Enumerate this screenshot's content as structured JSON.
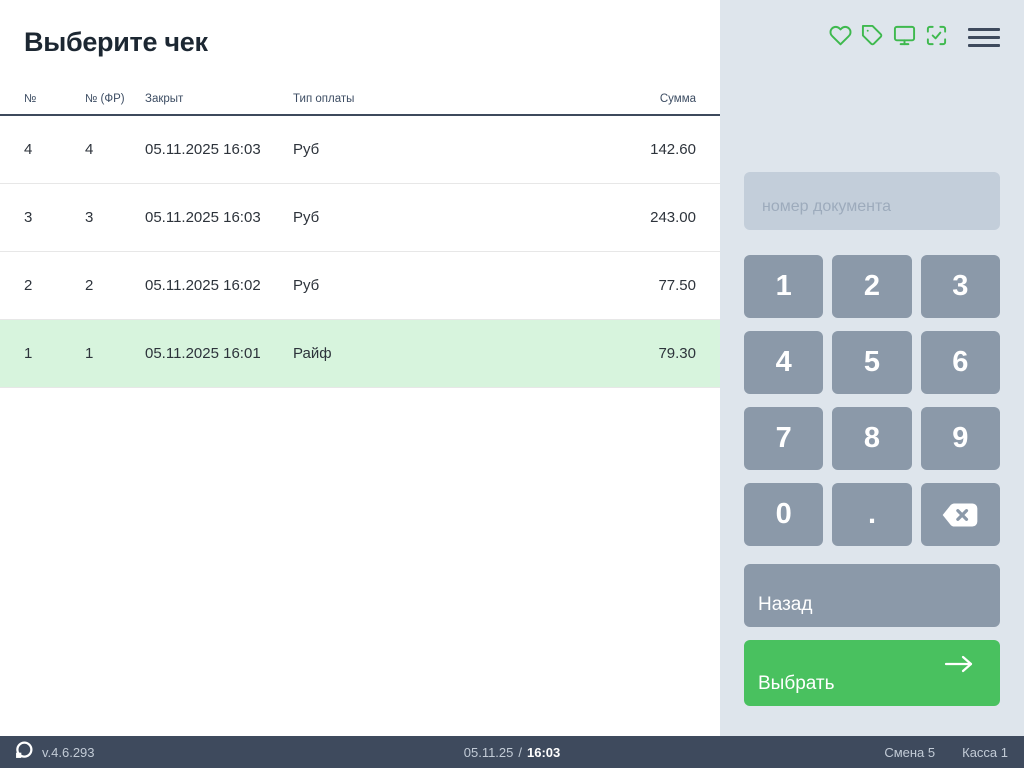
{
  "page": {
    "title": "Выберите чек"
  },
  "table": {
    "headers": {
      "num": "№",
      "num_fr": "№ (ФР)",
      "closed": "Закрыт",
      "payment": "Тип оплаты",
      "sum": "Сумма"
    },
    "rows": [
      {
        "num": "4",
        "num_fr": "4",
        "closed": "05.11.2025 16:03",
        "payment": "Руб",
        "sum": "142.60",
        "selected": false
      },
      {
        "num": "3",
        "num_fr": "3",
        "closed": "05.11.2025 16:03",
        "payment": "Руб",
        "sum": "243.00",
        "selected": false
      },
      {
        "num": "2",
        "num_fr": "2",
        "closed": "05.11.2025 16:02",
        "payment": "Руб",
        "sum": "77.50",
        "selected": false
      },
      {
        "num": "1",
        "num_fr": "1",
        "closed": "05.11.2025 16:01",
        "payment": "Райф",
        "sum": "79.30",
        "selected": true
      }
    ]
  },
  "sidebar": {
    "icons": [
      "heart-icon",
      "tag-icon",
      "monitor-icon",
      "scan-check-icon",
      "menu-icon"
    ],
    "doc_input": {
      "placeholder": "номер документа",
      "value": ""
    },
    "keypad": [
      "1",
      "2",
      "3",
      "4",
      "5",
      "6",
      "7",
      "8",
      "9",
      "0",
      ".",
      "backspace"
    ],
    "back_button": "Назад",
    "select_button": "Выбрать"
  },
  "statusbar": {
    "version": "v.4.6.293",
    "date": "05.11.25",
    "separator": "/",
    "time": "16:03",
    "shift": "Смена 5",
    "register": "Касса 1"
  },
  "colors": {
    "accent_green": "#3eb94e",
    "select_button_green": "#49c15f",
    "panel_bg": "#dee5ec",
    "keypad_button": "#8b99a9",
    "statusbar_bg": "#3e4a5d",
    "selected_row_bg": "#d7f4dd"
  }
}
